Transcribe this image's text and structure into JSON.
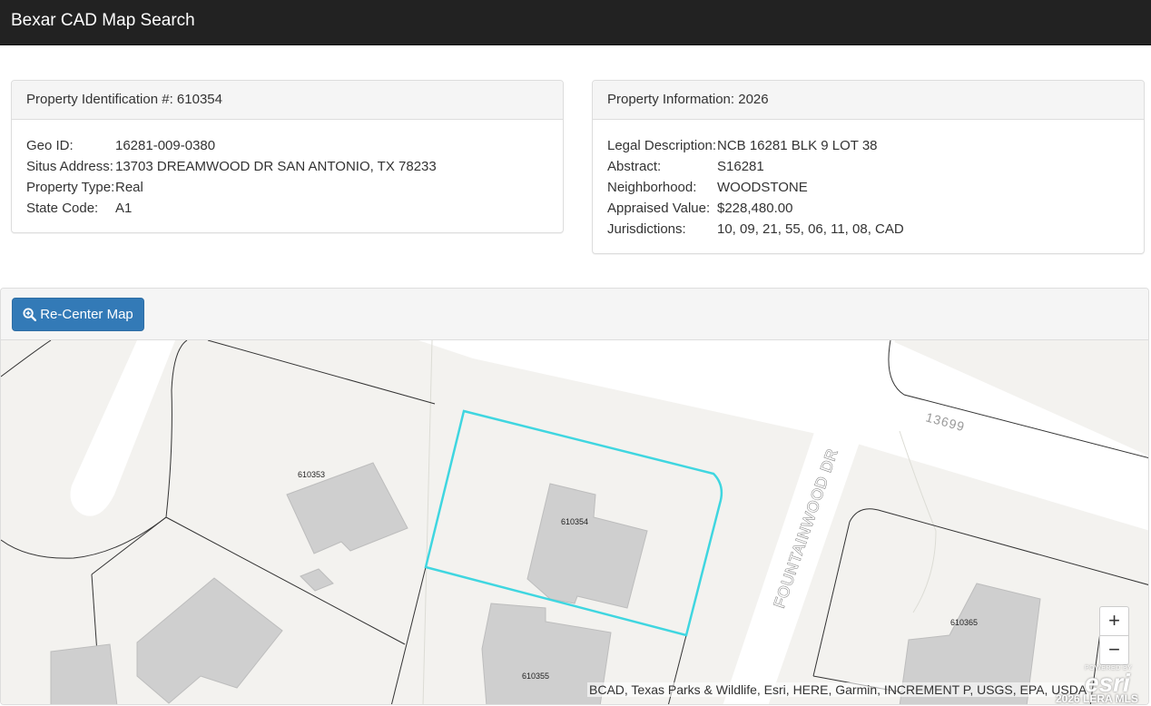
{
  "app": {
    "title": "Bexar CAD Map Search"
  },
  "identification": {
    "heading": "Property Identification #: 610354",
    "rows": [
      {
        "label": "Geo ID:",
        "value": "16281-009-0380"
      },
      {
        "label": "Situs Address:",
        "value": "13703 DREAMWOOD DR SAN ANTONIO, TX 78233"
      },
      {
        "label": "Property Type:",
        "value": "Real"
      },
      {
        "label": "State Code:",
        "value": "A1"
      }
    ]
  },
  "information": {
    "heading": "Property Information: 2026",
    "rows": [
      {
        "label": "Legal Description:",
        "value": "NCB 16281 BLK 9 LOT 38"
      },
      {
        "label": "Abstract:",
        "value": "S16281"
      },
      {
        "label": "Neighborhood:",
        "value": "WOODSTONE"
      },
      {
        "label": "Appraised Value:",
        "value": "$228,480.00"
      },
      {
        "label": "Jurisdictions:",
        "value": "10, 09, 21, 55, 06, 11, 08, CAD"
      }
    ]
  },
  "map": {
    "recenter_label": "Re-Center Map",
    "recenter_icon": "zoom-in-icon",
    "zoom_in": "+",
    "zoom_out": "−",
    "street_name": "FOUNTAINWOOD DR",
    "address_label": "13699",
    "parcels": {
      "p610353": "610353",
      "p610354": "610354",
      "p610355": "610355",
      "p610365": "610365"
    },
    "attribution": "BCAD, Texas Parks & Wildlife, Esri, HERE, Garmin, INCREMENT P, USGS, EPA, USDA",
    "esri_powered": "POWERED BY",
    "esri_logo": "esri",
    "watermark": "2026 LERA MLS",
    "selected_color": "#3fd6e0"
  }
}
